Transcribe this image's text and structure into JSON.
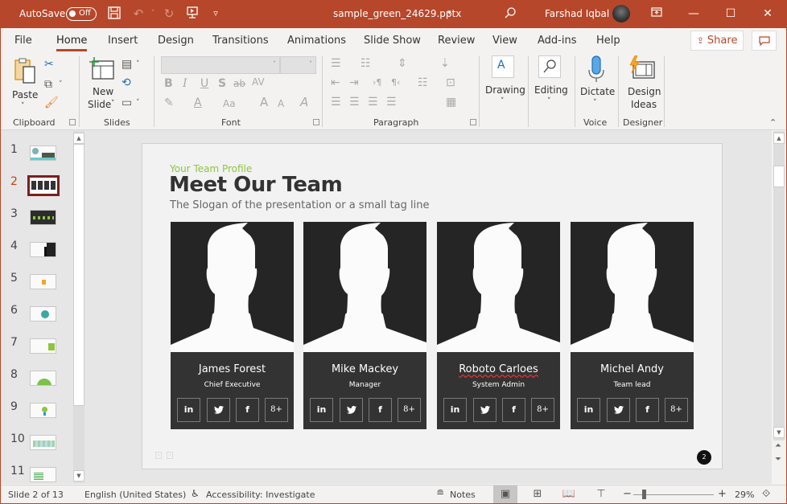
{
  "titlebar": {
    "autosave_label": "AutoSave",
    "autosave_state": "Off",
    "document_title": "sample_green_24629.pptx",
    "title_dropdown_icon": "▾",
    "user_name": "Farshad Iqbal",
    "icons": {
      "save": "🖫",
      "undo": "↶",
      "redo": "↻",
      "present": "⊡",
      "customize": "▿",
      "search": "⚲",
      "ribbon_display": "⊼",
      "minimize": "—",
      "maximize": "☐",
      "close": "✕"
    }
  },
  "tabs": [
    {
      "label": "File"
    },
    {
      "label": "Home",
      "active": true
    },
    {
      "label": "Insert"
    },
    {
      "label": "Design"
    },
    {
      "label": "Transitions"
    },
    {
      "label": "Animations"
    },
    {
      "label": "Slide Show"
    },
    {
      "label": "Review"
    },
    {
      "label": "View"
    },
    {
      "label": "Add-ins"
    },
    {
      "label": "Help"
    }
  ],
  "share_label": "Share",
  "ribbon": {
    "clipboard": {
      "label": "Clipboard",
      "paste_label": "Paste"
    },
    "slides": {
      "label": "Slides",
      "new_slide_line1": "New",
      "new_slide_line2": "Slide"
    },
    "font": {
      "label": "Font",
      "font_name": "",
      "font_size": "",
      "bold": "B",
      "italic": "I",
      "underline": "U",
      "shadow": "S",
      "strikethrough": "ab",
      "spacing": "AV",
      "change_case": "Aa",
      "grow": "A",
      "shrink": "A",
      "clear": "A"
    },
    "paragraph": {
      "label": "Paragraph"
    },
    "drawing_label": "Drawing",
    "editing_label": "Editing",
    "voice": {
      "label": "Voice",
      "dictate_label": "Dictate"
    },
    "designer": {
      "label": "Designer",
      "design_ideas_line1": "Design",
      "design_ideas_line2": "Ideas"
    }
  },
  "slides_pane": {
    "slides": [
      {
        "number": "1"
      },
      {
        "number": "2",
        "active": true
      },
      {
        "number": "3"
      },
      {
        "number": "4"
      },
      {
        "number": "5"
      },
      {
        "number": "6"
      },
      {
        "number": "7"
      },
      {
        "number": "8"
      },
      {
        "number": "9"
      },
      {
        "number": "10"
      },
      {
        "number": "11"
      }
    ]
  },
  "slide": {
    "tagline": "Your Team Profile",
    "title": "Meet Our Team",
    "slogan": "The Slogan of the presentation or a small tag line",
    "accent_color": "#8cc63f",
    "members": [
      {
        "name": "James Forest",
        "role": "Chief Executive"
      },
      {
        "name": "Mike Mackey",
        "role": "Manager"
      },
      {
        "name": "Roboto Carloes",
        "role": "System Admin"
      },
      {
        "name": "Michel Andy",
        "role": "Team lead"
      }
    ],
    "social": {
      "linkedin": "in",
      "twitter": "🐦",
      "facebook": "f",
      "googleplus": "8+"
    },
    "nav_prev": "‹",
    "nav_next": "›",
    "page_number": "2"
  },
  "status": {
    "slide_indicator": "Slide 2 of 13",
    "language": "English (United States)",
    "accessibility": "Accessibility: Investigate",
    "notes_label": "Notes",
    "zoom_level": "29%",
    "zoom_minus": "−",
    "zoom_plus": "+"
  }
}
